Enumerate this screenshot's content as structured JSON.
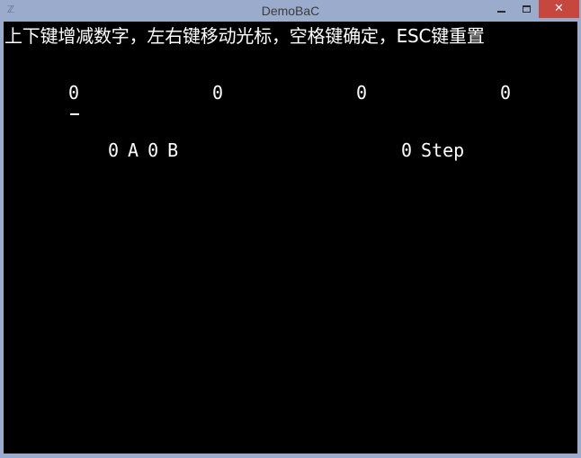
{
  "window": {
    "title": "DemoBaC",
    "app_icon_glyph": "ℤ",
    "close_glyph": "✕"
  },
  "console": {
    "instructions": "上下键增减数字，左右键移动光标，空格键确定，ESC键重置",
    "digits": [
      "0",
      "0",
      "0",
      "0"
    ],
    "cursor_position": 0,
    "result": {
      "a_count": "0",
      "a_label": "A",
      "b_count": "0",
      "b_label": "B",
      "step_count": "0",
      "step_label": "Step"
    }
  },
  "colors": {
    "console_bg": "#000000",
    "console_fg": "#ffffff",
    "titlebar_bg": "#9aabcc",
    "close_button_bg": "#c7463d"
  }
}
